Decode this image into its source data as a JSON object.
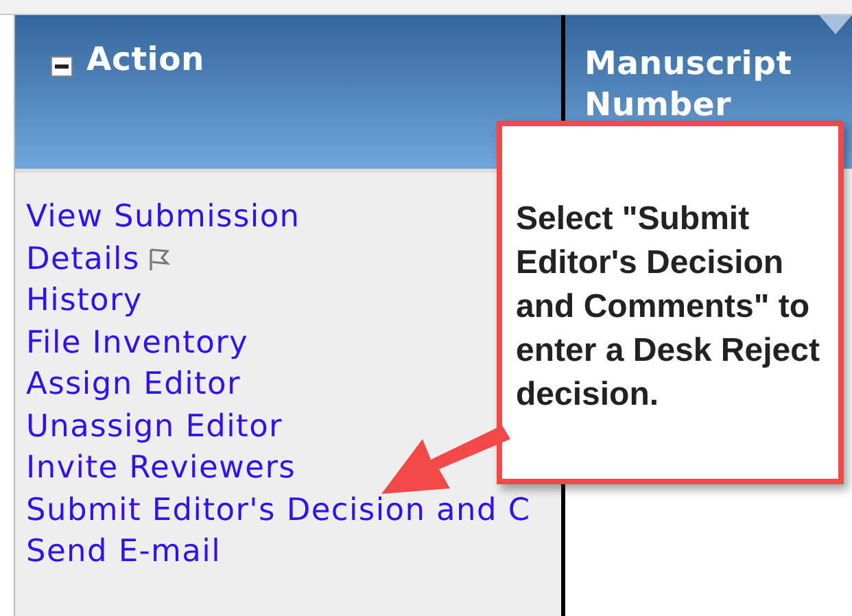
{
  "table": {
    "columns": [
      {
        "label": "Action",
        "expanded": true
      },
      {
        "label": "Manuscript Number"
      }
    ],
    "actions": [
      {
        "label": "View Submission",
        "flagged": false
      },
      {
        "label": "Details",
        "flagged": true
      },
      {
        "label": "History",
        "flagged": false
      },
      {
        "label": "File Inventory",
        "flagged": false
      },
      {
        "label": "Assign Editor",
        "flagged": false
      },
      {
        "label": "Unassign Editor",
        "flagged": false
      },
      {
        "label": "Invite Reviewers",
        "flagged": false
      },
      {
        "label": "Submit Editor's Decision and C",
        "flagged": false
      },
      {
        "label": "Send E-mail",
        "flagged": false
      }
    ]
  },
  "callout": {
    "text": "Select \"Submit Editor's Decision and Comments\" to enter a Desk Reject decision."
  }
}
